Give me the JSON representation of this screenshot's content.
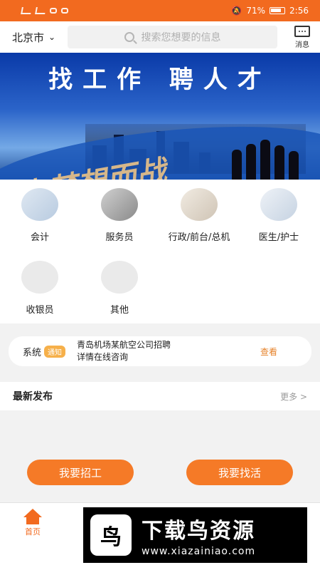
{
  "status_bar": {
    "battery_pct": "71%",
    "time": "2:56"
  },
  "header": {
    "city": "北京市",
    "search_placeholder": "搜索您想要的信息",
    "message_label": "消息"
  },
  "banner": {
    "title": "找工作 聘人才",
    "slogan": "为梦想而战"
  },
  "categories": [
    {
      "label": "会计",
      "icon": "calculator-icon"
    },
    {
      "label": "服务员",
      "icon": "waiter-icon"
    },
    {
      "label": "行政/前台/总机",
      "icon": "reception-icon"
    },
    {
      "label": "医生/护士",
      "icon": "doctor-icon"
    },
    {
      "label": "收银员",
      "icon": "cashier-icon"
    },
    {
      "label": "其他",
      "icon": "more-icon"
    }
  ],
  "notice": {
    "system": "系统",
    "badge": "通知",
    "line1": "青岛机场某航空公司招聘",
    "line2": "详情在线咨询",
    "view": "查看"
  },
  "latest": {
    "title": "最新发布",
    "more": "更多 >"
  },
  "actions": {
    "hire": "我要招工",
    "find_job": "我要找活"
  },
  "bottom_nav": {
    "home": "首页"
  },
  "watermark": {
    "title": "下载鸟资源",
    "url": "www.xiazainiao.com"
  },
  "colors": {
    "accent": "#f26a1f",
    "button": "#f57a27",
    "notice_badge": "#f6b04a"
  }
}
